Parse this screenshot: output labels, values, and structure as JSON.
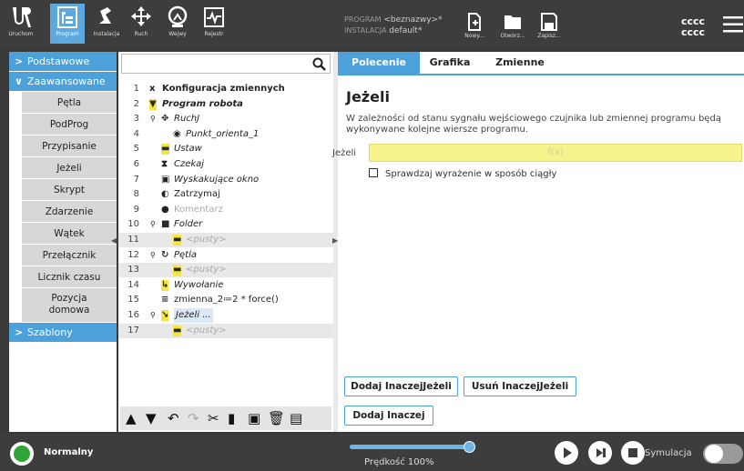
{
  "header": {
    "toolbar": [
      {
        "label": "Uruchom",
        "icon": "ur-logo-icon"
      },
      {
        "label": "Program",
        "icon": "program-icon"
      },
      {
        "label": "Instalacja",
        "icon": "installation-icon"
      },
      {
        "label": "Ruch",
        "icon": "move-icon"
      },
      {
        "label": "Wejwy",
        "icon": "io-icon"
      },
      {
        "label": "Rejestr",
        "icon": "log-icon"
      }
    ],
    "program_key": "PROGRAM",
    "program_value": "<beznazwy>*",
    "installation_key": "INSTALACJA",
    "installation_value": "default*",
    "file_buttons": [
      {
        "label": "Nowy...",
        "icon": "new-file-icon"
      },
      {
        "label": "Otwórz...",
        "icon": "folder-icon"
      },
      {
        "label": "Zapisz...",
        "icon": "save-icon"
      }
    ],
    "user_line1": "cccc",
    "user_line2": "cccc"
  },
  "sidebar": {
    "basic": "Podstawowe",
    "advanced": "Zaawansowane",
    "items": [
      "Pętla",
      "PodProg",
      "Przypisanie",
      "Jeżeli",
      "Skrypt",
      "Zdarzenie",
      "Wątek",
      "Przełącznik",
      "Licznik czasu"
    ],
    "item_home_line1": "Pozycja",
    "item_home_line2": "domowa",
    "templates": "Szablony"
  },
  "tree": {
    "search_placeholder": "",
    "rows": [
      {
        "num": "1",
        "text": "Konfiguracja zmiennych",
        "icon": "variables-icon"
      },
      {
        "num": "2",
        "text": "Program robota",
        "icon": "program-arrow-icon"
      },
      {
        "num": "3",
        "text": "RuchJ",
        "icon": "move-icon"
      },
      {
        "num": "4",
        "text": "Punkt_orienta_1",
        "icon": "waypoint-icon"
      },
      {
        "num": "5",
        "text": "Ustaw",
        "icon": "set-icon"
      },
      {
        "num": "6",
        "text": "Czekaj",
        "icon": "hourglass-icon"
      },
      {
        "num": "7",
        "text": "Wyskakujące okno",
        "icon": "popup-icon"
      },
      {
        "num": "8",
        "text": "Zatrzymaj",
        "icon": "stop-icon"
      },
      {
        "num": "9",
        "text": "Komentarz",
        "icon": "comment-icon"
      },
      {
        "num": "10",
        "text": "Folder",
        "icon": "folder-icon"
      },
      {
        "num": "11",
        "text": "<pusty>",
        "icon": "empty-icon"
      },
      {
        "num": "12",
        "text": "Pętla",
        "icon": "loop-icon"
      },
      {
        "num": "13",
        "text": "<pusty>",
        "icon": "empty-icon"
      },
      {
        "num": "14",
        "text": "Wywołanie",
        "icon": "call-icon"
      },
      {
        "num": "15",
        "text": "zmienna_2≔2 * force()",
        "icon": "assign-icon"
      },
      {
        "num": "16",
        "text": "Jeżeli ...",
        "icon": "if-icon"
      },
      {
        "num": "17",
        "text": "<pusty>",
        "icon": "empty-icon"
      }
    ]
  },
  "panel": {
    "tabs": [
      "Polecenie",
      "Grafika",
      "Zmienne"
    ],
    "title": "Jeżeli",
    "description": "W zależności od stanu sygnału wejściowego czujnika lub zmiennej programu będą wykonywane kolejne wiersze programu.",
    "if_label": "Jeżeli",
    "expression_placeholder": "f(x)",
    "checkbox_label": "Sprawdzaj wyrażenie w sposób ciągły",
    "btn_add_elseif": "Dodaj InaczejJeżeli",
    "btn_remove_elseif": "Usuń InaczejJeżeli",
    "btn_add_else": "Dodaj Inaczej"
  },
  "footer": {
    "status": "Normalny",
    "speed": "Prędkość 100%",
    "speed_value": 1.0,
    "simulation": "Symulacja"
  },
  "colors": {
    "accent": "#4da1db",
    "status_ok": "#2fa536",
    "expression_bg": "#f6f28c"
  }
}
